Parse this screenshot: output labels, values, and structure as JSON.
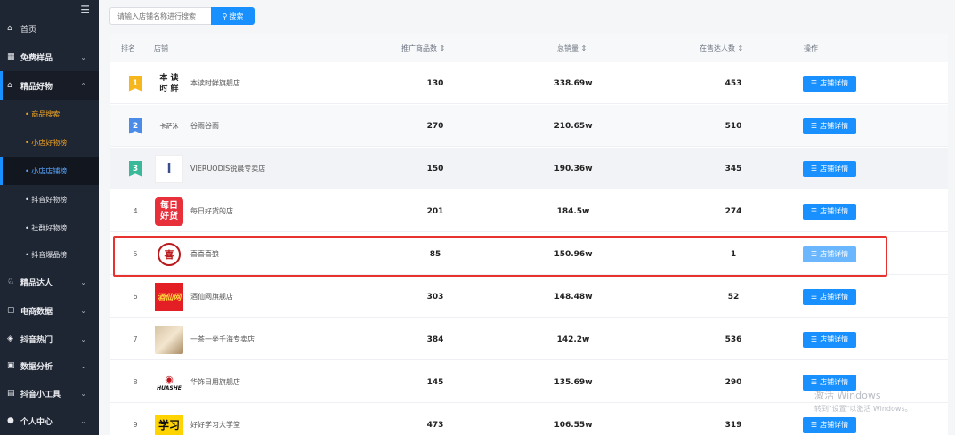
{
  "search": {
    "placeholder": "请输入店铺名称进行搜索",
    "button_label": "搜索"
  },
  "sidebar": {
    "top_items": [
      {
        "label": "首页",
        "icon": "home-icon"
      },
      {
        "label": "免费样品",
        "icon": "gift-icon"
      },
      {
        "label": "精品好物",
        "icon": "goods-icon"
      }
    ],
    "sub_items": [
      {
        "label": "• 商品搜索"
      },
      {
        "label": "• 小店好物榜"
      },
      {
        "label": "• 小店店铺榜"
      },
      {
        "label": "• 抖音好物榜"
      },
      {
        "label": "• 社群好物榜"
      },
      {
        "label": "• 抖音爆品榜"
      }
    ],
    "bottom_items": [
      {
        "label": "精品达人",
        "icon": "talent-icon"
      },
      {
        "label": "电商数据",
        "icon": "data-icon"
      },
      {
        "label": "抖音热门",
        "icon": "hot-icon"
      },
      {
        "label": "数据分析",
        "icon": "analysis-icon"
      },
      {
        "label": "抖音小工具",
        "icon": "tool-icon"
      },
      {
        "label": "个人中心",
        "icon": "user-icon"
      }
    ]
  },
  "table": {
    "headers": {
      "rank": "排名",
      "store": "店铺",
      "products": "推广商品数 ⇕",
      "sales": "总销量 ⇕",
      "talents": "在售达人数 ⇕",
      "ops": "操作"
    },
    "op_label": "店铺详情",
    "rows": [
      {
        "rank": "1",
        "logo_text": "本 读\n时 鲜",
        "store": "本读时鲜旗舰店",
        "products": "130",
        "sales": "338.69w",
        "talents": "453"
      },
      {
        "rank": "2",
        "logo_text": "卡萨沐",
        "store": "谷雨谷雨",
        "products": "270",
        "sales": "210.65w",
        "talents": "510"
      },
      {
        "rank": "3",
        "logo_text": "i",
        "store": "VIERUODIS锐晨专卖店",
        "products": "150",
        "sales": "190.36w",
        "talents": "345"
      },
      {
        "rank": "4",
        "logo_text": "每日\n好货",
        "store": "每日好货的店",
        "products": "201",
        "sales": "184.5w",
        "talents": "274"
      },
      {
        "rank": "5",
        "logo_text": "喜",
        "store": "喜喜喜狼",
        "products": "85",
        "sales": "150.96w",
        "talents": "1"
      },
      {
        "rank": "6",
        "logo_text": "酒仙网",
        "store": "酒仙网旗舰店",
        "products": "303",
        "sales": "148.48w",
        "talents": "52"
      },
      {
        "rank": "7",
        "logo_text": "",
        "store": "一茶一坐千海专卖店",
        "products": "384",
        "sales": "142.2w",
        "talents": "536"
      },
      {
        "rank": "8",
        "logo_text": "HUASHE",
        "store": "华饰日用旗舰店",
        "products": "145",
        "sales": "135.69w",
        "talents": "290"
      },
      {
        "rank": "9",
        "logo_text": "学习",
        "store": "好好学习大学堂",
        "products": "473",
        "sales": "106.55w",
        "talents": "319"
      }
    ]
  },
  "watermark": {
    "line1": "激活 Windows",
    "line2": "转到\"设置\"以激活 Windows。"
  },
  "colors": {
    "accent": "#1890ff",
    "sidebar_bg": "#1f2633",
    "highlight": "#e8322f",
    "orange": "#f5a623"
  }
}
